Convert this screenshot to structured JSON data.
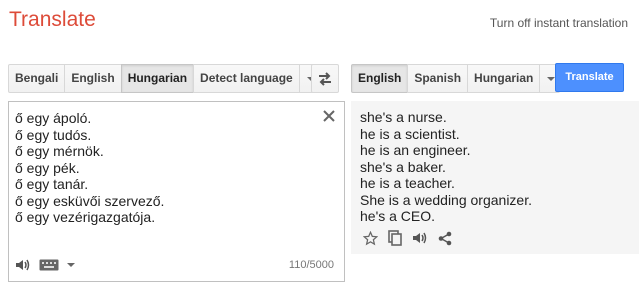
{
  "header": {
    "title": "Translate",
    "instant_link": "Turn off instant translation"
  },
  "source_langs": {
    "buttons": [
      {
        "label": "Bengali",
        "active": false
      },
      {
        "label": "English",
        "active": false
      },
      {
        "label": "Hungarian",
        "active": true
      },
      {
        "label": "Detect language",
        "active": false
      }
    ]
  },
  "target_langs": {
    "buttons": [
      {
        "label": "English",
        "active": true
      },
      {
        "label": "Spanish",
        "active": false
      },
      {
        "label": "Hungarian",
        "active": false
      }
    ]
  },
  "translate_button": {
    "label": "Translate"
  },
  "source": {
    "lines": [
      "ő egy ápoló.",
      "ő egy tudós.",
      "ő egy mérnök.",
      "ő egy pék.",
      "ő egy tanár.",
      "ő egy esküvői szervező.",
      "ő egy vezérigazgatója."
    ],
    "char_count": "110/5000"
  },
  "output": {
    "lines": [
      "she's a nurse.",
      "he is a scientist.",
      "he is an engineer.",
      "she's a baker.",
      "he is a teacher.",
      "She is a wedding organizer.",
      "he's a CEO."
    ]
  },
  "colors": {
    "title": "#dd4b39",
    "translate_button": "#4d90fe",
    "output_bg": "#f5f5f5"
  },
  "icons": {
    "swap": "swap-arrows-icon",
    "clear": "close-icon",
    "listen": "speaker-icon",
    "keyboard": "keyboard-icon",
    "star": "star-icon",
    "copy": "copy-icon",
    "share": "share-icon"
  }
}
